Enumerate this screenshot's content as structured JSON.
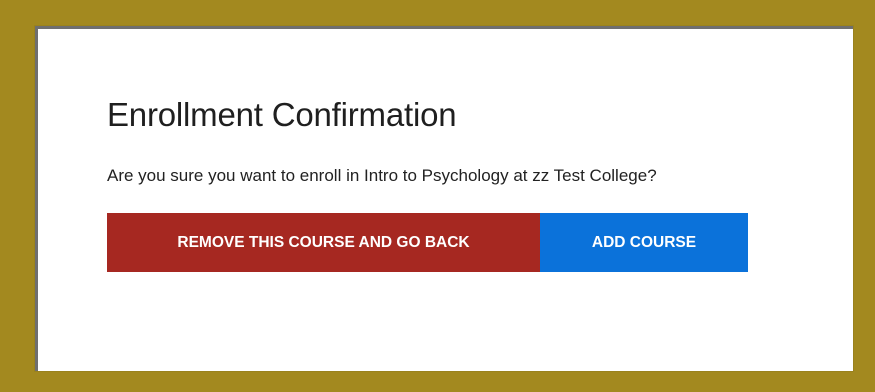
{
  "dialog": {
    "title": "Enrollment Confirmation",
    "message": "Are you sure you want to enroll in Intro to Psychology at zz Test College?",
    "remove_label": "REMOVE THIS COURSE AND GO BACK",
    "add_label": "ADD COURSE"
  },
  "colors": {
    "frame": "#a3891f",
    "remove_button": "#a62821",
    "add_button": "#0b72da"
  }
}
